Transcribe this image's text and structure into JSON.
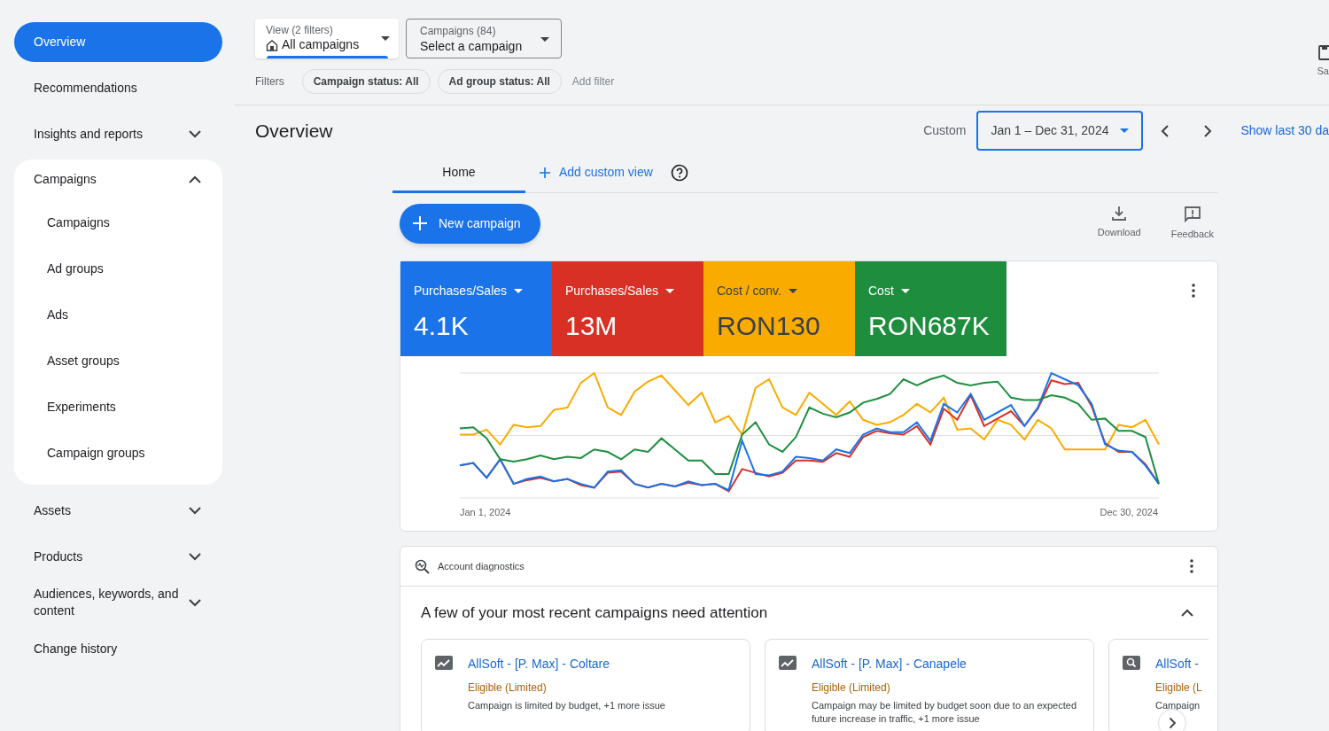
{
  "sidebar": {
    "items": [
      {
        "kind": "link",
        "label": "Overview",
        "selected": true
      },
      {
        "kind": "link",
        "label": "Recommendations",
        "selected": false
      },
      {
        "kind": "group",
        "label": "Insights and reports",
        "selected": false,
        "expanded": false
      },
      {
        "kind": "group",
        "label": "Campaigns",
        "selected": false,
        "expanded": true,
        "children": [
          {
            "label": "Campaigns",
            "selected": false
          },
          {
            "label": "Ad groups",
            "selected": false
          },
          {
            "label": "Ads",
            "selected": false
          },
          {
            "label": "Asset groups",
            "selected": false
          },
          {
            "label": "Experiments",
            "selected": false
          },
          {
            "label": "Campaign groups",
            "selected": false
          }
        ]
      },
      {
        "kind": "group",
        "label": "Assets",
        "selected": false,
        "expanded": false
      },
      {
        "kind": "group",
        "label": "Products",
        "selected": false,
        "expanded": false
      },
      {
        "kind": "group",
        "label": "Audiences, keywords, and content",
        "selected": false,
        "expanded": false
      },
      {
        "kind": "link",
        "label": "Change history",
        "selected": false
      }
    ]
  },
  "view_selector": {
    "caption": "View (2 filters)",
    "value": "All campaigns"
  },
  "campaign_selector": {
    "caption": "Campaigns (84)",
    "value": "Select a campaign"
  },
  "filters": {
    "label": "Filters",
    "chips": [
      "Campaign status: All",
      "Ad group status: All"
    ],
    "add": "Add filter"
  },
  "corner_action": {
    "label": "Sa"
  },
  "page_title": "Overview",
  "date_range": {
    "label": "Custom",
    "value": "Jan 1 – Dec 31, 2024",
    "link": "Show last 30 da"
  },
  "tabs": [
    {
      "label": "Home",
      "selected": true
    }
  ],
  "add_view": "Add custom view",
  "new_campaign": "New campaign",
  "actions": [
    {
      "kind": "download",
      "label": "Download"
    },
    {
      "kind": "feedback",
      "label": "Feedback"
    }
  ],
  "metrics": [
    {
      "label": "Purchases/Sales",
      "value": "4.1K",
      "color": "#1a73e8"
    },
    {
      "label": "Purchases/Sales",
      "value": "13M",
      "color": "#d93025"
    },
    {
      "label": "Cost / conv.",
      "value": "RON130",
      "color": "#f9ab00"
    },
    {
      "label": "Cost",
      "value": "RON687K",
      "color": "#1e8e3e"
    }
  ],
  "chart": {
    "start_label": "Jan 1, 2024",
    "end_label": "Dec 30, 2024"
  },
  "diagnostics": {
    "title": "Account diagnostics",
    "heading": "A few of your most recent campaigns need attention",
    "expanded": true,
    "cards": [
      {
        "kind": "trend",
        "name": "AllSoft - [P. Max] - Coltare",
        "status": "Eligible (Limited)",
        "detail": "Campaign is limited by budget, +1 more issue"
      },
      {
        "kind": "trend",
        "name": "AllSoft - [P. Max] - Canapele",
        "status": "Eligible (Limited)",
        "detail": "Campaign may be limited by budget soon due to an expected future increase in traffic, +1 more issue"
      },
      {
        "kind": "search",
        "name": "AllSoft -",
        "status": "Eligible (L",
        "detail": "Campaign"
      }
    ]
  }
}
